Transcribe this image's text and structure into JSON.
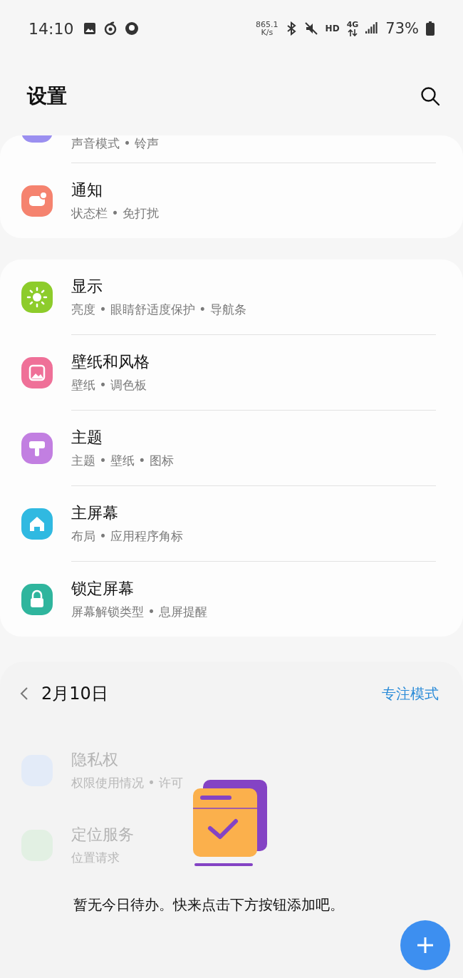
{
  "status_bar": {
    "time": "14:10",
    "speed_value": "865.1",
    "speed_unit": "K/s",
    "hd": "HD",
    "network": "4G",
    "battery": "73%"
  },
  "header": {
    "title": "设置"
  },
  "groups": [
    {
      "items": [
        {
          "subtitle": "声音模式 • 铃声",
          "color": "#9b8ff0"
        },
        {
          "title": "通知",
          "subtitle": "状态栏 • 免打扰",
          "color": "#f5836f"
        }
      ]
    },
    {
      "items": [
        {
          "title": "显示",
          "subtitle": "亮度 • 眼睛舒适度保护 • 导航条",
          "color": "#8dcc2b"
        },
        {
          "title": "壁纸和风格",
          "subtitle": "壁纸 • 调色板",
          "color": "#ef7098"
        },
        {
          "title": "主题",
          "subtitle": "主题 • 壁纸 • 图标",
          "color": "#c27fe1"
        },
        {
          "title": "主屏幕",
          "subtitle": "布局 • 应用程序角标",
          "color": "#30b9e1"
        },
        {
          "title": "锁定屏幕",
          "subtitle": "屏幕解锁类型 • 息屏提醒",
          "color": "#2fb59d"
        }
      ]
    }
  ],
  "faded_items": [
    {
      "title": "隐私权",
      "subtitle": "权限使用情况 • 许可",
      "color": "#e3ebf8"
    },
    {
      "title": "定位服务",
      "subtitle": "位置请求",
      "color": "#e2f0e3"
    }
  ],
  "todo_panel": {
    "date": "2月10日",
    "focus_mode": "专注模式",
    "empty_message": "暂无今日待办。快来点击下方按钮添加吧。"
  }
}
